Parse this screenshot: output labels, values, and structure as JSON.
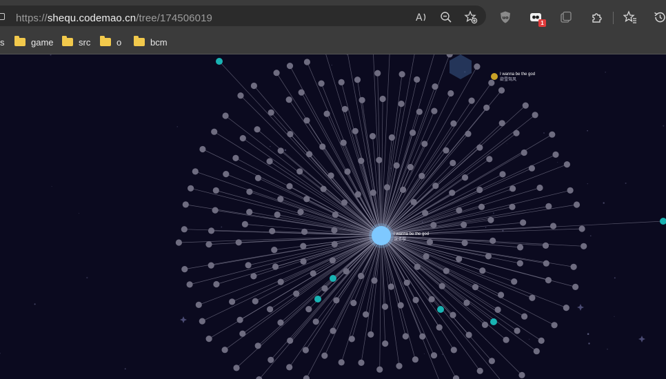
{
  "browser": {
    "url_host": "shequ.codemao.cn",
    "url_prefix": "https://",
    "url_path": "/tree/174506019",
    "extension_badge": "1",
    "icons": [
      "read-aloud-icon",
      "zoom-out-icon",
      "add-favorite-icon",
      "ublock-icon",
      "extension-icon",
      "collections-icon",
      "extensions-puzzle-icon",
      "favorites-icon",
      "history-icon"
    ]
  },
  "bookmarks": [
    {
      "label": "s"
    },
    {
      "label": "game"
    },
    {
      "label": "src"
    },
    {
      "label": "o"
    },
    {
      "label": "bcm"
    }
  ],
  "tree": {
    "center_label": "I wanna be the god",
    "center_sublabel": "课清樱",
    "corner_label": "I wanna be the god",
    "corner_sublabel": "欲雪驾风",
    "colors": {
      "background": "#0b0a1f",
      "node": "#6e6c80",
      "line": "#9a98ad",
      "highlight": "#19b3b3",
      "center": "#7ec8ff",
      "gold": "#c9a227"
    }
  }
}
